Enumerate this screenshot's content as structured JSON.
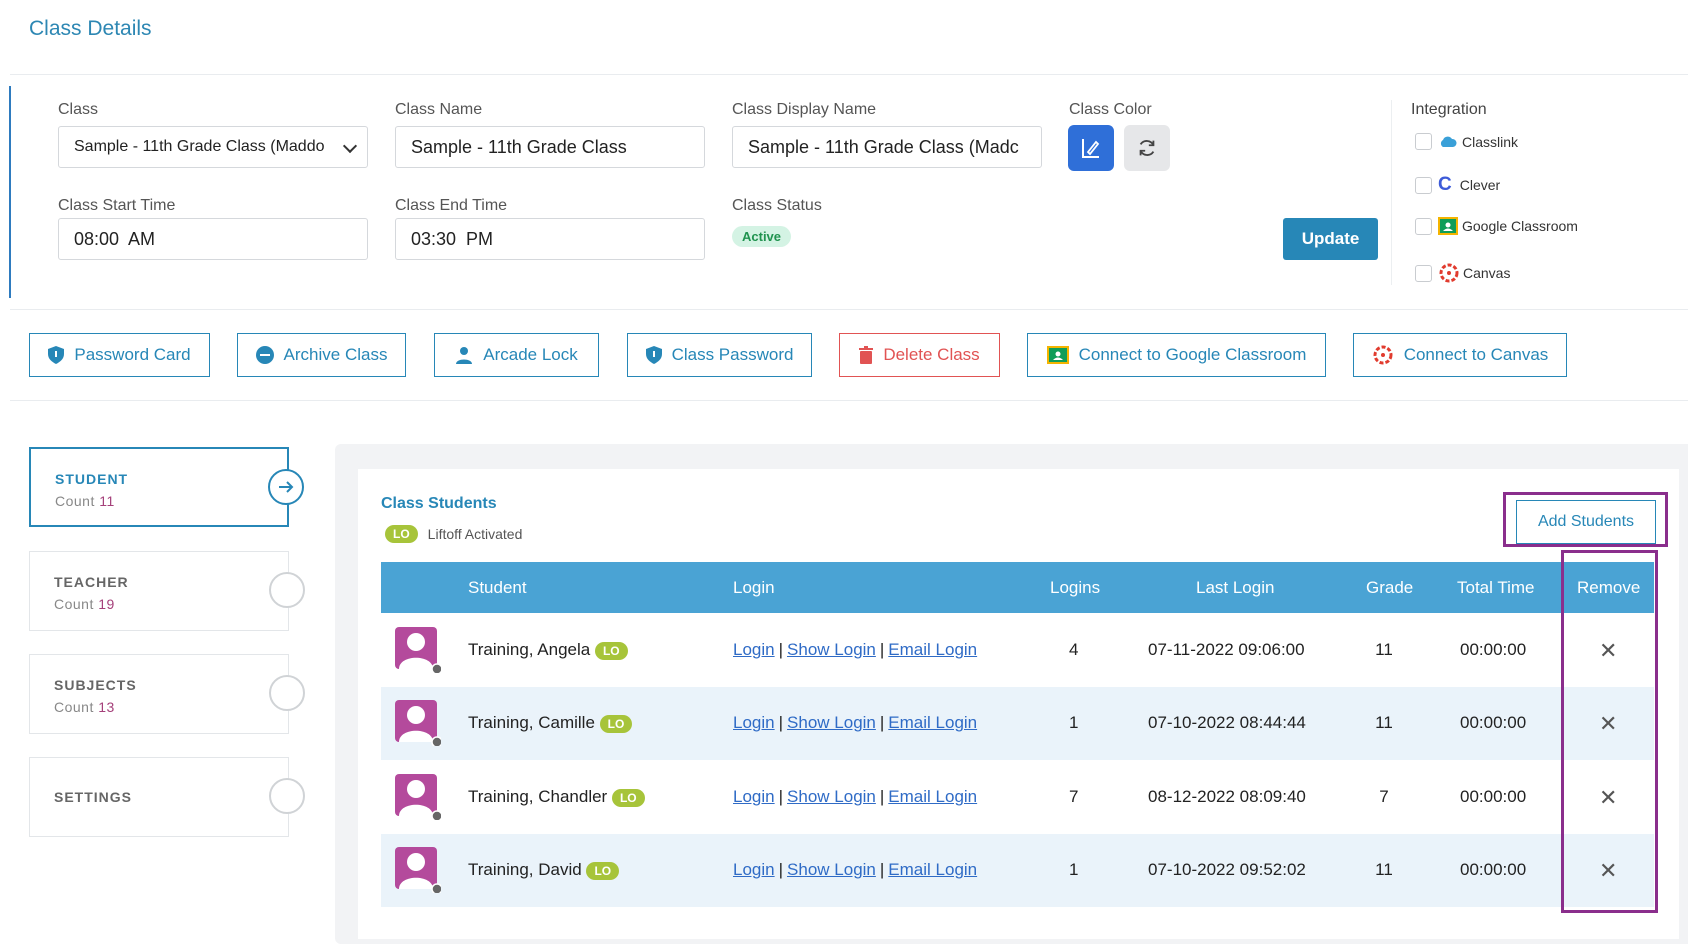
{
  "page_title": "Class Details",
  "form": {
    "class_label": "Class",
    "class_value": "Sample - 11th Grade Class (Maddo",
    "class_name_label": "Class Name",
    "class_name_value": "Sample - 11th Grade Class",
    "class_display_name_label": "Class Display Name",
    "class_display_name_value": "Sample - 11th Grade Class (Madc",
    "class_color_label": "Class Color",
    "class_color_value": "#2f6fd8",
    "class_start_label": "Class Start Time",
    "class_start_value": "08:00  AM",
    "class_end_label": "Class End Time",
    "class_end_value": "03:30  PM",
    "class_status_label": "Class Status",
    "class_status_value": "Active",
    "update_label": "Update"
  },
  "integration": {
    "label": "Integration",
    "items": [
      "Classlink",
      "Clever",
      "Google Classroom",
      "Canvas"
    ]
  },
  "actions": [
    "Password Card",
    "Archive Class",
    "Arcade Lock",
    "Class Password",
    "Delete Class",
    "Connect to Google Classroom",
    "Connect to Canvas"
  ],
  "tabs": [
    {
      "title": "STUDENT",
      "count_label": "Count",
      "count": "11"
    },
    {
      "title": "TEACHER",
      "count_label": "Count",
      "count": "19"
    },
    {
      "title": "SUBJECTS",
      "count_label": "Count",
      "count": "13"
    },
    {
      "title": "SETTINGS"
    }
  ],
  "students_panel": {
    "title": "Class Students",
    "lo_badge": "LO",
    "lo_legend": "Liftoff Activated",
    "add_students_label": "Add Students",
    "columns": [
      "Student",
      "Login",
      "Logins",
      "Last Login",
      "Grade",
      "Total Time",
      "Remove"
    ],
    "login_links": [
      "Login",
      "Show Login",
      "Email Login"
    ],
    "remove_symbol": "✕",
    "rows": [
      {
        "name": "Training, Angela",
        "badge": "LO",
        "logins": "4",
        "last_login": "07-11-2022 09:06:00",
        "grade": "11",
        "total_time": "00:00:00"
      },
      {
        "name": "Training, Camille",
        "badge": "LO",
        "logins": "1",
        "last_login": "07-10-2022 08:44:44",
        "grade": "11",
        "total_time": "00:00:00"
      },
      {
        "name": "Training, Chandler",
        "badge": "LO",
        "logins": "7",
        "last_login": "08-12-2022 08:09:40",
        "grade": "7",
        "total_time": "00:00:00"
      },
      {
        "name": "Training, David",
        "badge": "LO",
        "logins": "1",
        "last_login": "07-10-2022 09:52:02",
        "grade": "11",
        "total_time": "00:00:00"
      }
    ]
  }
}
